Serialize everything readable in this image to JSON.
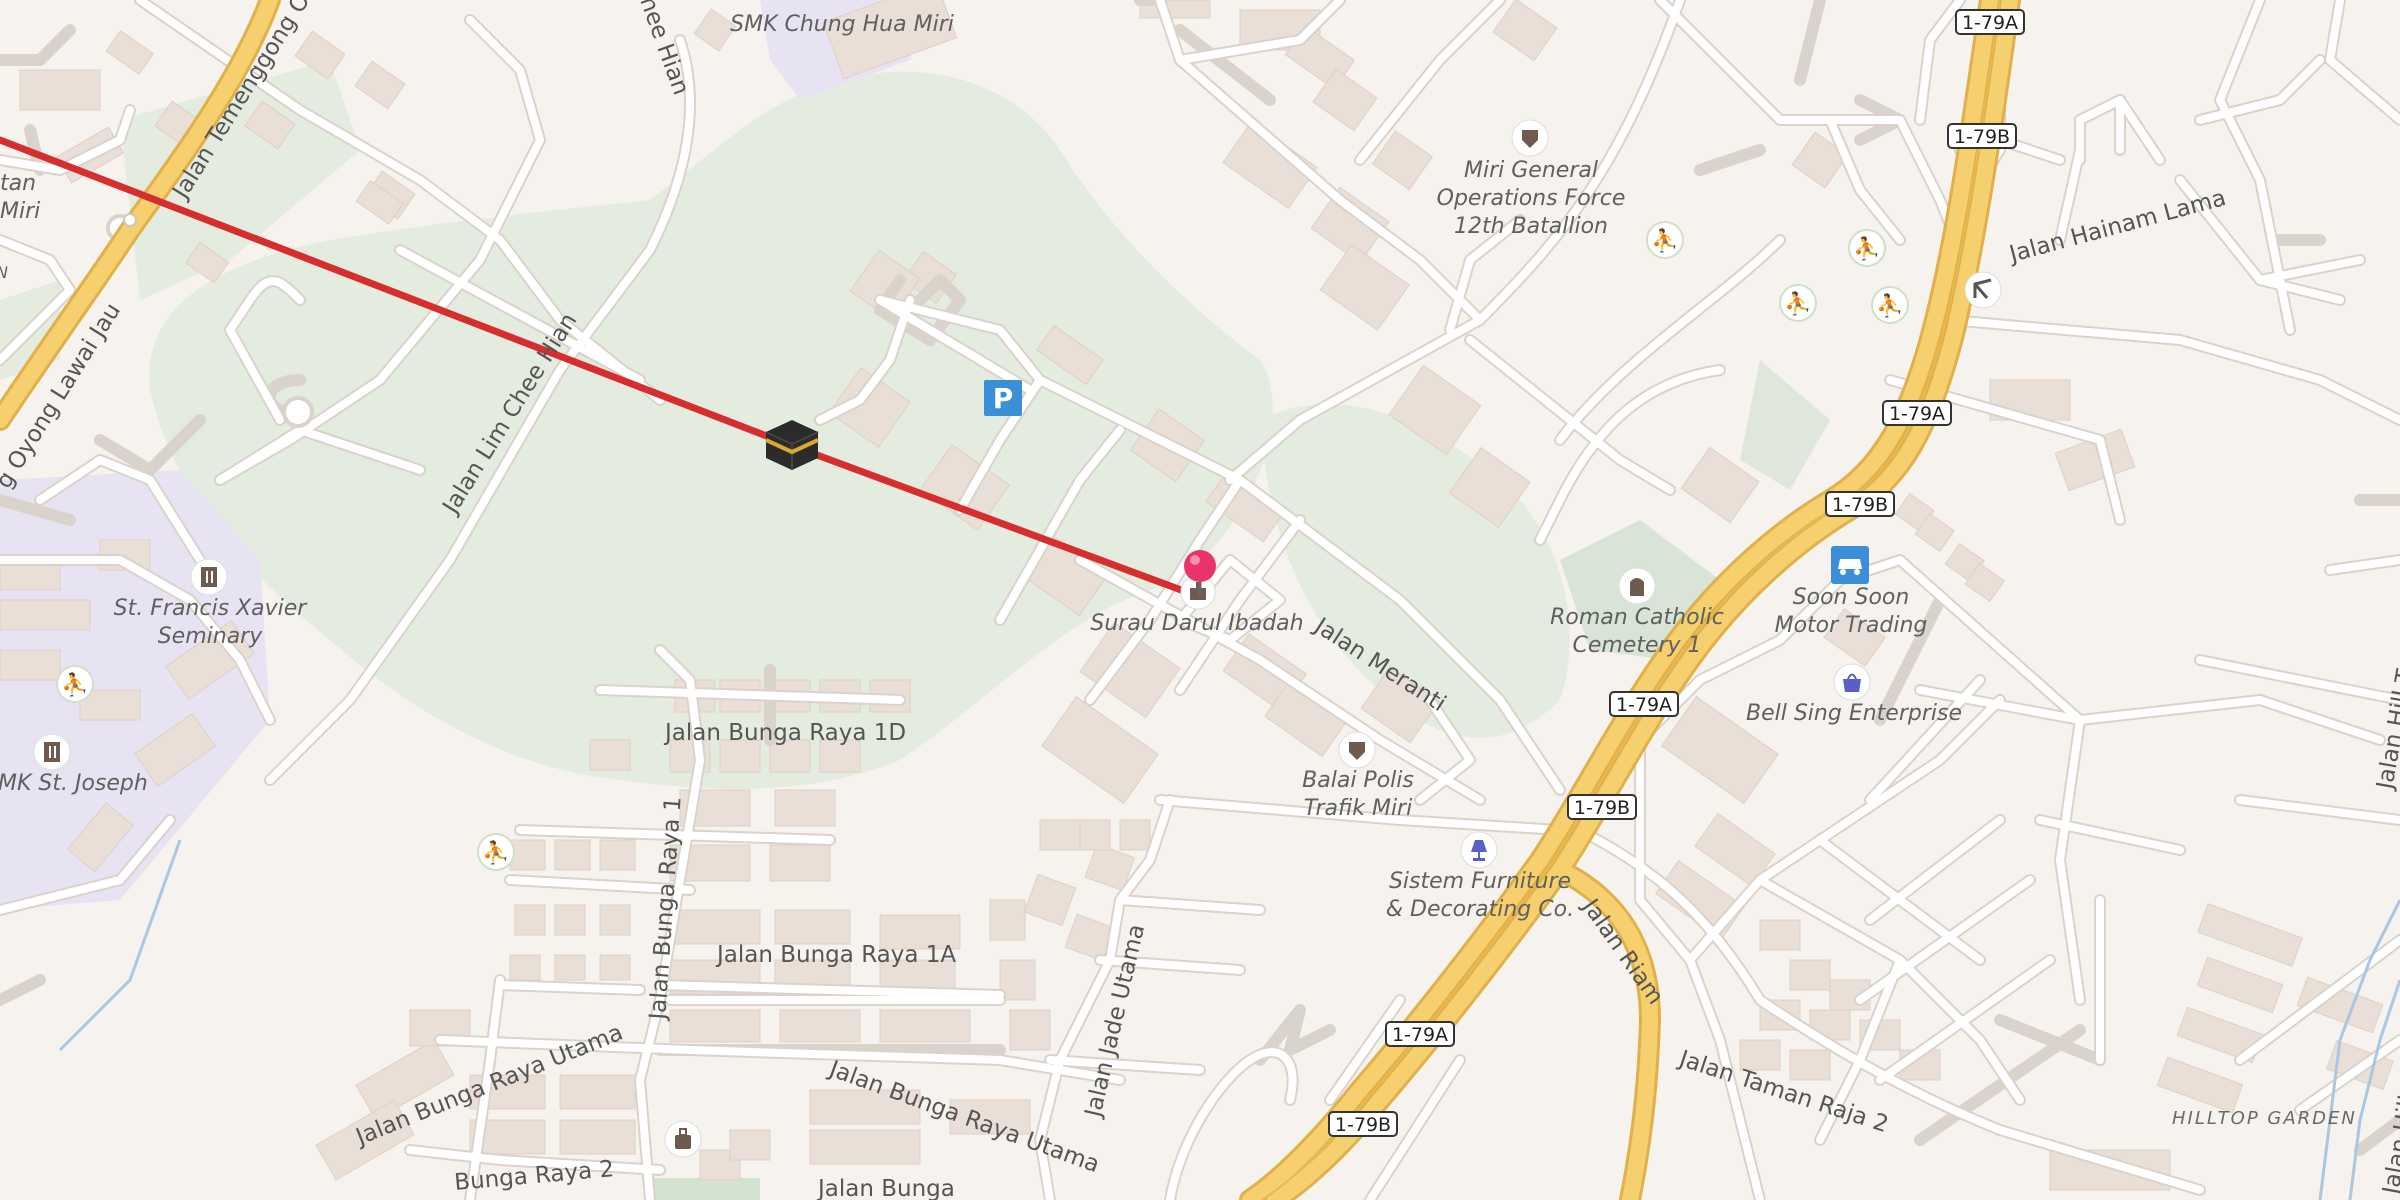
{
  "map": {
    "colors": {
      "background": "#f6f3ee",
      "green_area": "#e4ebdf",
      "school_area": "#e8e3f3",
      "highway": "#f6cf6e",
      "highway_casing": "#e0b04a",
      "road": "#ffffff",
      "road_casing": "#d9d3cb",
      "building": "#eadfd6",
      "route_line": "#d62d2d",
      "pin": "#e8336b"
    },
    "route_marker_icon": "kaaba-icon",
    "destination_pin_icon": "map-pin-icon",
    "streets": {
      "jalan_temenggong": "Jalan Temenggong O",
      "jalan_oyong_lawai_jau": "g Oyong Lawai Jau",
      "jalan_lim_chee_hian": "Jalan Lim Chee Hian",
      "chee_hian_top": "hee Hian",
      "jalan_hainam_lama": "Jalan Hainam Lama",
      "jalan_meranti": "Jalan Meranti",
      "jalan_bunga_raya_1d": "Jalan Bunga Raya 1D",
      "jalan_bunga_raya_1a": "Jalan Bunga Raya 1A",
      "jalan_bunga_raya_1": "Jalan Bunga Raya 1",
      "jalan_bunga_raya_utama_a": "Jalan Bunga Raya Utama",
      "jalan_bunga_raya_utama_b": "Jalan Bunga Raya Utama",
      "jalan_bunga_raya_2": "Bunga Raya 2",
      "jalan_bunga_bottom": "Jalan Bunga",
      "jalan_jade_utama": "Jalan Jade Utama",
      "jalan_riam": "Jalan Riam",
      "jalan_taman_raja_2": "Jalan Taman Raja 2",
      "jalan_hill_top_1": "Jalan Hill To",
      "jalan_hill_top_2": "Jalan Hill T",
      "hilltop_garden": "HILLTOP GARDEN"
    },
    "shields": [
      "1-79A",
      "1-79B",
      "1-79A",
      "1-79B",
      "1-79A",
      "1-79B",
      "1-79A",
      "1-79B"
    ],
    "pois": {
      "smk_chung_hua_miri": "SMK Chung Hua Miri",
      "miri_general_ops_line1": "Miri General",
      "miri_general_ops_line2": "Operations Force",
      "miri_general_ops_line3": "12th Batallion",
      "surau_darul_ibadah": "Surau Darul Ibadah",
      "st_francis_line1": "St. Francis Xavier",
      "st_francis_line2": "Seminary",
      "smk_st_joseph": "MK St. Joseph",
      "balai_polis_line1": "Balai Polis",
      "balai_polis_line2": "Trafik Miri",
      "sistem_furniture_line1": "Sistem Furniture",
      "sistem_furniture_line2": "& Decorating Co.",
      "roman_catholic_line1": "Roman Catholic",
      "roman_catholic_line2": "Cemetery 1",
      "soon_soon_line1": "Soon Soon",
      "soon_soon_line2": "Motor Trading",
      "bell_sing": "Bell Sing Enterprise",
      "tan_fragment": "tan",
      "miri_fragment": "Miri",
      "n_fragment": "N"
    }
  }
}
